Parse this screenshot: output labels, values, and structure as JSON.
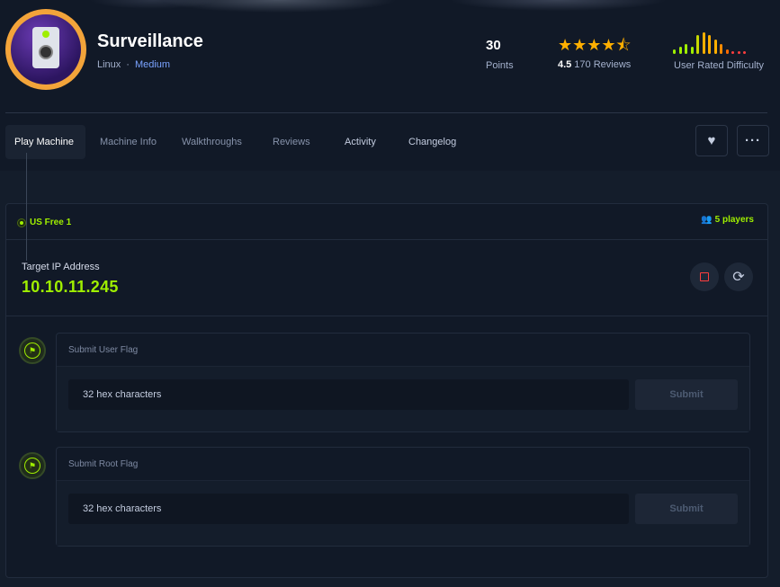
{
  "machine": {
    "name": "Surveillance",
    "os": "Linux",
    "separator": "·",
    "difficulty": "Medium",
    "points": "30",
    "points_label": "Points",
    "stars": "★★★★⯪",
    "rating": "4.5",
    "reviews": "170 Reviews",
    "difficulty_label": "User Rated Difficulty",
    "difficulty_distribution": [
      2,
      3,
      4,
      3,
      8,
      9,
      8,
      6,
      4,
      2,
      1,
      1,
      1
    ]
  },
  "tabs": [
    {
      "label": "Play Machine"
    },
    {
      "label": "Machine Info"
    },
    {
      "label": "Walkthroughs"
    },
    {
      "label": "Reviews"
    },
    {
      "label": "Activity"
    },
    {
      "label": "Changelog"
    }
  ],
  "icons": {
    "favorite": "heart-icon",
    "more": "more-icon"
  },
  "server": {
    "name": "US Free 1",
    "players": "5 players"
  },
  "target": {
    "label": "Target IP Address",
    "ip": "10.10.11.245"
  },
  "flags": [
    {
      "title": "Submit User Flag",
      "placeholder": "32 hex characters",
      "button": "Submit"
    },
    {
      "title": "Submit Root Flag",
      "placeholder": "32 hex characters",
      "button": "Submit"
    }
  ],
  "colors": {
    "accent": "#9fef00",
    "stars": "#ffaf00",
    "stop": "#ff3e3e",
    "link": "#7aa3ff"
  }
}
